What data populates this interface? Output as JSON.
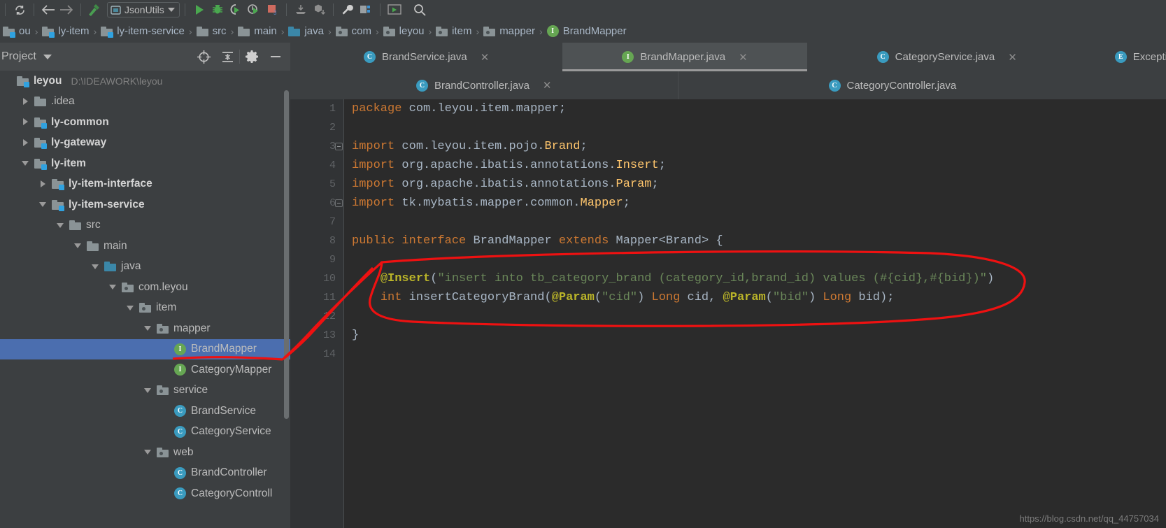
{
  "toolbar": {
    "icons": [
      {
        "name": "sync-icon",
        "glyph": "sync"
      },
      {
        "name": "back-arrow-icon",
        "glyph": "back"
      },
      {
        "name": "forward-arrow-icon",
        "glyph": "forward"
      },
      {
        "name": "build-hammer-icon",
        "glyph": "hammer"
      }
    ],
    "run_config_label": "JsonUtils",
    "right_icons": [
      {
        "name": "run-icon",
        "glyph": "run"
      },
      {
        "name": "debug-icon",
        "glyph": "debug"
      },
      {
        "name": "run-with-coverage-icon",
        "glyph": "coverage"
      },
      {
        "name": "profile-icon",
        "glyph": "profile"
      },
      {
        "name": "stop-icon",
        "glyph": "stop"
      },
      {
        "name": "update-project-icon",
        "glyph": "update"
      },
      {
        "name": "commit-icon",
        "glyph": "commit"
      },
      {
        "name": "settings-wrench-icon",
        "glyph": "wrench"
      },
      {
        "name": "project-structure-icon",
        "glyph": "structure"
      },
      {
        "name": "search-everywhere-icon",
        "glyph": "search"
      }
    ]
  },
  "breadcrumb": {
    "items": [
      {
        "label": "ou",
        "icon": "module-folder-icon",
        "type": "module"
      },
      {
        "label": "ly-item",
        "icon": "module-folder-icon",
        "type": "module"
      },
      {
        "label": "ly-item-service",
        "icon": "module-folder-icon",
        "type": "module"
      },
      {
        "label": "src",
        "icon": "folder-icon",
        "type": "folder"
      },
      {
        "label": "main",
        "icon": "folder-icon",
        "type": "folder"
      },
      {
        "label": "java",
        "icon": "source-folder-icon",
        "type": "source"
      },
      {
        "label": "com",
        "icon": "package-folder-icon",
        "type": "package"
      },
      {
        "label": "leyou",
        "icon": "package-folder-icon",
        "type": "package"
      },
      {
        "label": "item",
        "icon": "package-folder-icon",
        "type": "package"
      },
      {
        "label": "mapper",
        "icon": "package-folder-icon",
        "type": "package"
      },
      {
        "label": "BrandMapper",
        "icon": "interface-icon",
        "type": "interface"
      }
    ],
    "separator": "›"
  },
  "project_panel": {
    "title": "Project",
    "header_icons": [
      {
        "name": "locate-target-icon",
        "glyph": "target"
      },
      {
        "name": "collapse-all-icon",
        "glyph": "collapse"
      },
      {
        "name": "settings-gear-icon",
        "glyph": "gear"
      },
      {
        "name": "hide-panel-icon",
        "glyph": "minus"
      }
    ],
    "tree": [
      {
        "label": "leyou",
        "sub": "D:\\IDEAWORK\\leyou",
        "indent": 0,
        "arrow": "none",
        "icon": "module-folder-icon",
        "bold": true,
        "selected": false
      },
      {
        "label": ".idea",
        "sub": "",
        "indent": 1,
        "arrow": "closed",
        "icon": "folder-icon",
        "bold": false,
        "selected": false
      },
      {
        "label": "ly-common",
        "sub": "",
        "indent": 1,
        "arrow": "closed",
        "icon": "module-folder-icon",
        "bold": true,
        "selected": false
      },
      {
        "label": "ly-gateway",
        "sub": "",
        "indent": 1,
        "arrow": "closed",
        "icon": "module-folder-icon",
        "bold": true,
        "selected": false
      },
      {
        "label": "ly-item",
        "sub": "",
        "indent": 1,
        "arrow": "open",
        "icon": "module-folder-icon",
        "bold": true,
        "selected": false
      },
      {
        "label": "ly-item-interface",
        "sub": "",
        "indent": 2,
        "arrow": "closed",
        "icon": "module-folder-icon",
        "bold": true,
        "selected": false
      },
      {
        "label": "ly-item-service",
        "sub": "",
        "indent": 2,
        "arrow": "open",
        "icon": "module-folder-icon",
        "bold": true,
        "selected": false
      },
      {
        "label": "src",
        "sub": "",
        "indent": 3,
        "arrow": "open",
        "icon": "folder-icon",
        "bold": false,
        "selected": false
      },
      {
        "label": "main",
        "sub": "",
        "indent": 4,
        "arrow": "open",
        "icon": "folder-icon",
        "bold": false,
        "selected": false
      },
      {
        "label": "java",
        "sub": "",
        "indent": 5,
        "arrow": "open",
        "icon": "source-folder-icon",
        "bold": false,
        "selected": false
      },
      {
        "label": "com.leyou",
        "sub": "",
        "indent": 6,
        "arrow": "open",
        "icon": "package-folder-icon",
        "bold": false,
        "selected": false
      },
      {
        "label": "item",
        "sub": "",
        "indent": 7,
        "arrow": "open",
        "icon": "package-folder-icon",
        "bold": false,
        "selected": false
      },
      {
        "label": "mapper",
        "sub": "",
        "indent": 8,
        "arrow": "open",
        "icon": "package-folder-icon",
        "bold": false,
        "selected": false
      },
      {
        "label": "BrandMapper",
        "sub": "",
        "indent": 9,
        "arrow": "none",
        "icon": "interface-icon",
        "bold": false,
        "selected": true
      },
      {
        "label": "CategoryMapper",
        "sub": "",
        "indent": 9,
        "arrow": "none",
        "icon": "interface-icon",
        "bold": false,
        "selected": false
      },
      {
        "label": "service",
        "sub": "",
        "indent": 8,
        "arrow": "open",
        "icon": "package-folder-icon",
        "bold": false,
        "selected": false
      },
      {
        "label": "BrandService",
        "sub": "",
        "indent": 9,
        "arrow": "none",
        "icon": "class-icon",
        "bold": false,
        "selected": false
      },
      {
        "label": "CategoryService",
        "sub": "",
        "indent": 9,
        "arrow": "none",
        "icon": "class-icon",
        "bold": false,
        "selected": false
      },
      {
        "label": "web",
        "sub": "",
        "indent": 8,
        "arrow": "open",
        "icon": "package-folder-icon",
        "bold": false,
        "selected": false
      },
      {
        "label": "BrandController",
        "sub": "",
        "indent": 9,
        "arrow": "none",
        "icon": "class-icon",
        "bold": false,
        "selected": false
      },
      {
        "label": "CategoryControll",
        "sub": "",
        "indent": 9,
        "arrow": "none",
        "icon": "class-icon",
        "bold": false,
        "selected": false
      }
    ]
  },
  "editor": {
    "tabs_row1": [
      {
        "label": "BrandService.java",
        "icon": "class-icon",
        "active": false,
        "close": "✕"
      },
      {
        "label": "BrandMapper.java",
        "icon": "interface-icon",
        "active": true,
        "close": "✕"
      },
      {
        "label": "CategoryService.java",
        "icon": "class-icon",
        "active": false,
        "close": "✕"
      },
      {
        "label": "ExceptionEnum.jav",
        "icon": "enum-icon",
        "active": false,
        "close": ""
      }
    ],
    "tabs_row2": [
      {
        "label": "BrandController.java",
        "icon": "class-icon",
        "active": false,
        "close": "✕"
      },
      {
        "label": "CategoryController.java",
        "icon": "class-icon",
        "active": false,
        "close": ""
      }
    ],
    "line_numbers": [
      "1",
      "2",
      "3",
      "4",
      "5",
      "6",
      "7",
      "8",
      "9",
      "10",
      "11",
      "12",
      "13",
      "14"
    ],
    "code_lines": [
      "package com.leyou.item.mapper;",
      "",
      "import com.leyou.item.pojo.Brand;",
      "import org.apache.ibatis.annotations.Insert;",
      "import org.apache.ibatis.annotations.Param;",
      "import tk.mybatis.mapper.common.Mapper;",
      "",
      "public interface BrandMapper extends Mapper<Brand> {",
      "",
      "    @Insert(\"insert into tb_category_brand (category_id,brand_id) values (#{cid},#{bid})\")",
      "    int insertCategoryBrand(@Param(\"cid\") Long cid, @Param(\"bid\") Long bid);",
      "",
      "}",
      ""
    ]
  },
  "watermark": "https://blog.csdn.net/qq_44757034",
  "colors": {
    "panel_bg": "#3c3f41",
    "editor_bg": "#2b2b2b",
    "gutter_bg": "#313335",
    "selection_blue": "#4b6eaf",
    "keyword_orange": "#cc7832",
    "string_green": "#6a8759",
    "annotation_yellow": "#bbb529",
    "class_yellow": "#ffc66d",
    "text_grey": "#a9b7c6",
    "annotation_red": "#ee1111",
    "interface_green": "#66a653",
    "class_teal": "#3a9bbf"
  }
}
